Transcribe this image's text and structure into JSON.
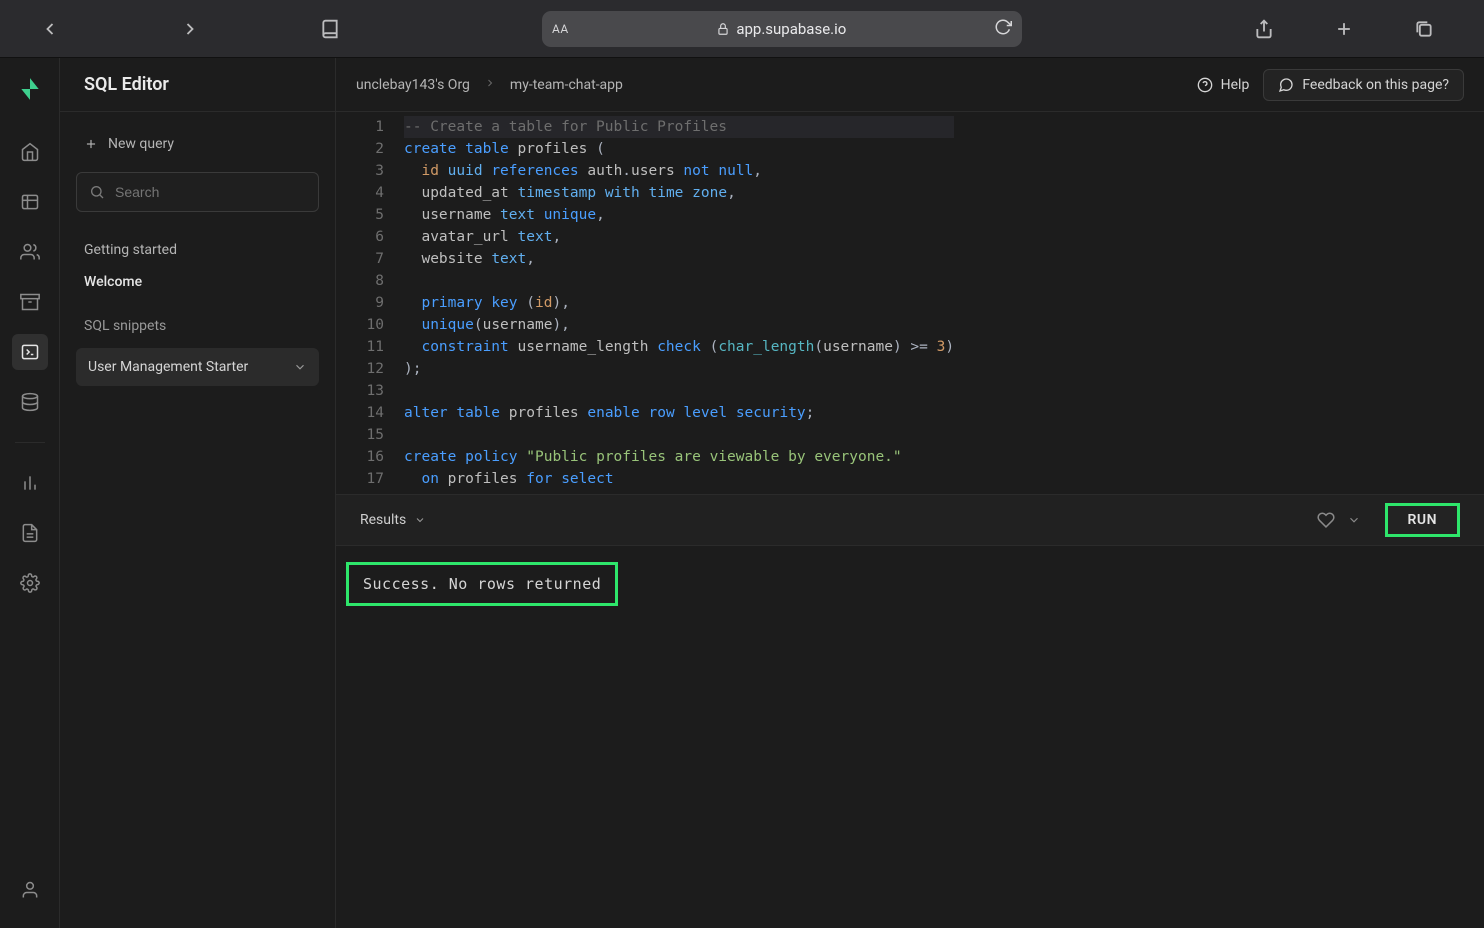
{
  "browser": {
    "url": "app.supabase.io",
    "textsize_label": "AA"
  },
  "rail": {
    "items": [
      "home",
      "table",
      "auth",
      "storage",
      "sql",
      "database",
      "reports",
      "logs",
      "settings",
      "user"
    ]
  },
  "sidebar": {
    "title": "SQL Editor",
    "new_query": "New query",
    "search_placeholder": "Search",
    "getting_started": "Getting started",
    "welcome": "Welcome",
    "snippets_label": "SQL snippets",
    "snippet_active": "User Management Starter"
  },
  "topbar": {
    "crumb_org": "unclebay143's Org",
    "crumb_project": "my-team-chat-app",
    "help": "Help",
    "feedback": "Feedback on this page?"
  },
  "editor": {
    "lines": [
      "-- Create a table for Public Profiles",
      "create table profiles (",
      "  id uuid references auth.users not null,",
      "  updated_at timestamp with time zone,",
      "  username text unique,",
      "  avatar_url text,",
      "  website text,",
      "",
      "  primary key (id),",
      "  unique(username),",
      "  constraint username_length check (char_length(username) >= 3)",
      ");",
      "",
      "alter table profiles enable row level security;",
      "",
      "create policy \"Public profiles are viewable by everyone.\"",
      "  on profiles for select"
    ]
  },
  "results": {
    "label": "Results",
    "run": "RUN",
    "message": "Success. No rows returned"
  }
}
